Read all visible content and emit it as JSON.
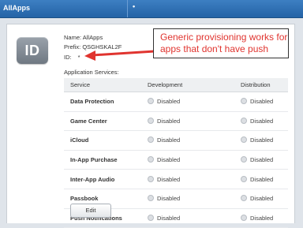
{
  "window": {
    "title": "AllApps",
    "tab_marker": "•"
  },
  "app_id": {
    "badge": "ID",
    "name_line": "Name: AllApps",
    "prefix_line": "Prefix: QSGHSKAL2F",
    "id_label": "ID:",
    "id_value": "*"
  },
  "callout": {
    "text": "Generic provisioning works for apps that don't have push",
    "color": "#e0342f"
  },
  "services": {
    "section_label": "Application Services:",
    "headers": [
      "Service",
      "Development",
      "Distribution"
    ],
    "rows": [
      {
        "service": "Data Protection",
        "development": "Disabled",
        "distribution": "Disabled"
      },
      {
        "service": "Game Center",
        "development": "Disabled",
        "distribution": "Disabled"
      },
      {
        "service": "iCloud",
        "development": "Disabled",
        "distribution": "Disabled"
      },
      {
        "service": "In-App Purchase",
        "development": "Disabled",
        "distribution": "Disabled"
      },
      {
        "service": "Inter-App Audio",
        "development": "Disabled",
        "distribution": "Disabled"
      },
      {
        "service": "Passbook",
        "development": "Disabled",
        "distribution": "Disabled"
      },
      {
        "service": "Push Notifications",
        "development": "Disabled",
        "distribution": "Disabled"
      }
    ]
  },
  "actions": {
    "edit_label": "Edit"
  },
  "colors": {
    "topbar": "#2d6fb3",
    "accent": "#e0342f"
  }
}
